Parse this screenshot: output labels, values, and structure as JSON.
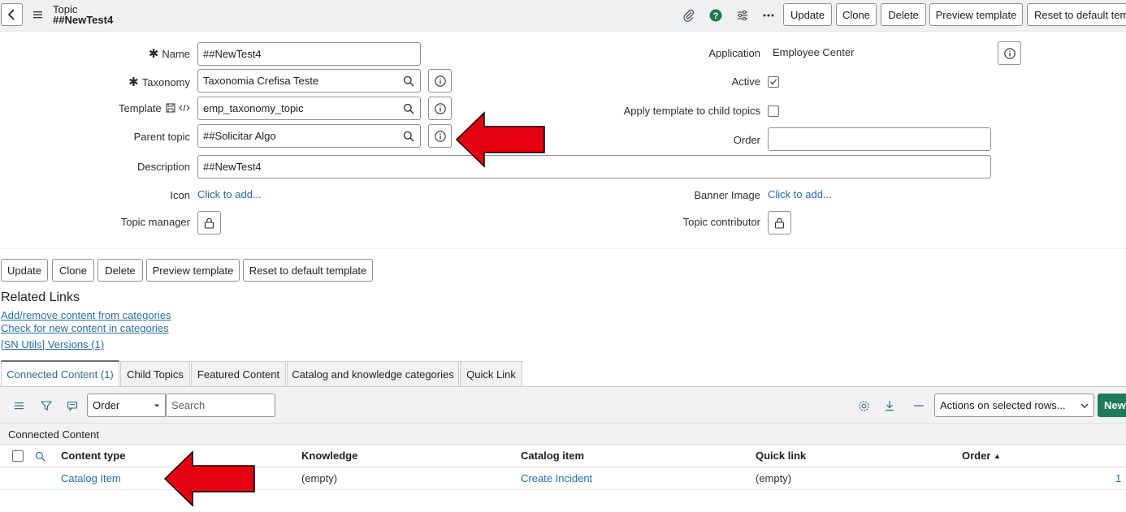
{
  "header": {
    "record_type": "Topic",
    "record_name": "##NewTest4",
    "icons": [
      "back-icon",
      "menu-icon",
      "attachment-icon",
      "help-icon",
      "settings-sliders-icon",
      "more-icon"
    ],
    "buttons": {
      "update": "Update",
      "clone": "Clone",
      "delete": "Delete",
      "preview": "Preview template",
      "reset": "Reset to default template"
    }
  },
  "form": {
    "name": {
      "label": "Name",
      "value": "##NewTest4",
      "required": true
    },
    "taxonomy": {
      "label": "Taxonomy",
      "value": "Taxonomia Crefisa Teste",
      "required": true
    },
    "template": {
      "label": "Template",
      "value": "emp_taxonomy_topic"
    },
    "parent_topic": {
      "label": "Parent topic",
      "value": "##Solicitar Algo"
    },
    "description": {
      "label": "Description",
      "value": "##NewTest4"
    },
    "icon": {
      "label": "Icon",
      "value": "Click to add..."
    },
    "topic_manager": {
      "label": "Topic manager"
    },
    "application": {
      "label": "Application",
      "value": "Employee Center"
    },
    "active": {
      "label": "Active",
      "checked": true
    },
    "apply_template": {
      "label": "Apply template to child topics",
      "checked": false
    },
    "order": {
      "label": "Order",
      "value": ""
    },
    "banner_image": {
      "label": "Banner Image",
      "value": "Click to add..."
    },
    "topic_contributor": {
      "label": "Topic contributor"
    }
  },
  "bottom_buttons": {
    "update": "Update",
    "clone": "Clone",
    "delete": "Delete",
    "preview": "Preview template",
    "reset": "Reset to default template"
  },
  "related_links": {
    "title": "Related Links",
    "links": [
      "Add/remove content from categories",
      "Check for new content in categories",
      "[SN Utils] Versions (1)"
    ]
  },
  "tabs": [
    {
      "label": "Connected Content (1)",
      "active": true
    },
    {
      "label": "Child Topics",
      "active": false
    },
    {
      "label": "Featured Content",
      "active": false
    },
    {
      "label": "Catalog and knowledge categories",
      "active": false
    },
    {
      "label": "Quick Link",
      "active": false
    }
  ],
  "list": {
    "order_select": "Order",
    "search_placeholder": "Search",
    "actions_select": "Actions on selected rows...",
    "new_button": "New",
    "caption": "Connected Content",
    "columns": [
      "Content type",
      "Knowledge",
      "Catalog item",
      "Quick link",
      "Order"
    ],
    "sort_indicator": "▲",
    "rows": [
      {
        "content_type": "Catalog Item",
        "knowledge": "(empty)",
        "catalog_item": "Create Incident",
        "quick_link": "(empty)",
        "order": "1"
      }
    ]
  },
  "colors": {
    "link": "#2770a8",
    "active_tab_text": "#2b6e86",
    "new_button": "#1d7a5a",
    "help_icon": "#1b7a50",
    "arrow": "#e5000f"
  }
}
